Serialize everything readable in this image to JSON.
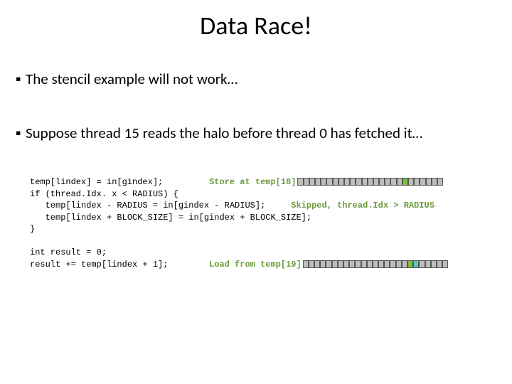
{
  "title": "Data Race!",
  "bullets": [
    "The stencil example will not work…",
    "Suppose thread 15 reads the halo before thread 0 has fetched it…"
  ],
  "code": {
    "l1_a": "temp[lindex] = in[gindex];         ",
    "l1_ann": "Store at temp[18]",
    "l2": "if (thread.Idx. x < RADIUS) {",
    "l3_a": "   temp[lindex - RADIUS = in[gindex - RADIUS];     ",
    "l3_ann": "Skipped, thread.Idx > RADIUS",
    "l4": "   temp[lindex + BLOCK_SIZE] = in[gindex + BLOCK_SIZE];",
    "l5": "}",
    "l6": "",
    "l7": "int result = 0;",
    "l8_a": "result += temp[lindex + 1];        ",
    "l8_ann": "Load from temp[19]"
  },
  "strip1": {
    "total": 25,
    "green_index": 18
  },
  "strip2": {
    "total": 25,
    "green_index": 18,
    "cyan_index": 19
  },
  "chart_data": null
}
